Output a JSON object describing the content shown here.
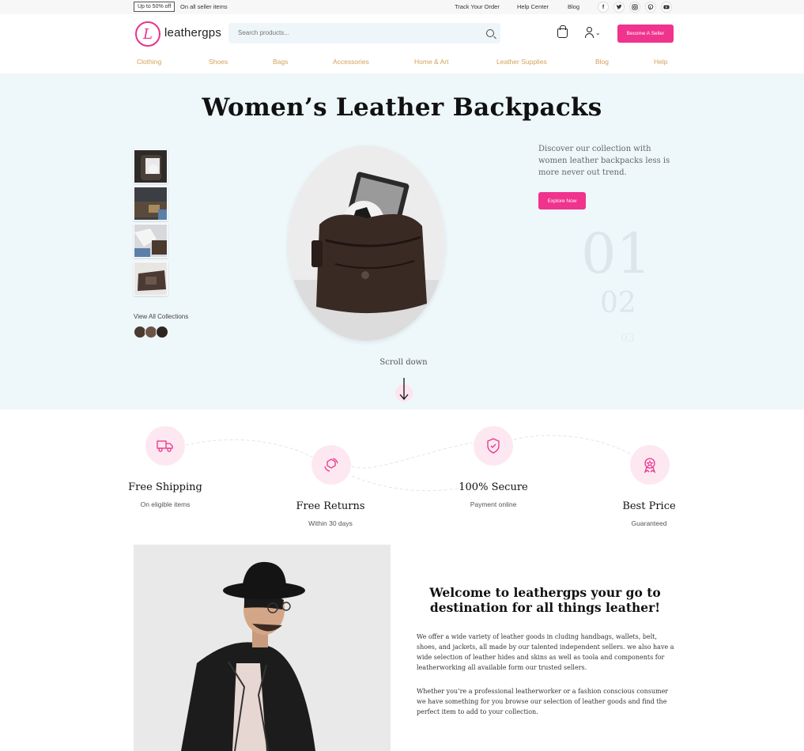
{
  "topbar": {
    "promo_badge": "Up to 50% off",
    "promo_note": "On all seller items",
    "links": [
      "Track Your Order",
      "Help Center",
      "Blog"
    ],
    "socials": [
      "facebook-icon",
      "twitter-icon",
      "instagram-icon",
      "pinterest-icon",
      "youtube-icon"
    ]
  },
  "header": {
    "logo_text": "leathergps",
    "search_placeholder": "Search products...",
    "seller_button": "Become A Seller"
  },
  "nav": [
    "Clothing",
    "Shoes",
    "Bags",
    "Accessories",
    "Home & Art",
    "Leather Supplies",
    "Blog",
    "Help"
  ],
  "hero": {
    "title": "Women’s Leather Backpacks",
    "description": "Discover our collection with women leather backpacks less is more never out trend.",
    "explore_button": "Explore Now",
    "view_all": "View All Collections",
    "slide_numbers": [
      "01",
      "02",
      "03"
    ],
    "scroll_label": "Scroll down"
  },
  "features": [
    {
      "title": "Free Shipping",
      "subtitle": "On eligible items"
    },
    {
      "title": "Free Returns",
      "subtitle": "Within 30 days"
    },
    {
      "title": "100% Secure",
      "subtitle": "Payment online"
    },
    {
      "title": "Best Price",
      "subtitle": "Guaranteed"
    }
  ],
  "welcome": {
    "title": "Welcome to leathergps your go to destination for all things leather!",
    "paragraph1": "We offer a wide variety of leather goods in cluding handbags, wallets, belt, shoes, and jackets, all made by our talented independent sellers. we also have a wide selection of leather hides and skins as well as toola and components for leatherworking all available form our trusted sellers.",
    "paragraph2": "Whether you’re a professional leatherworker or a fashion conscious consumer we have something for you browse our selection of leather goods and find the perfect item to add to your collection."
  },
  "colors": {
    "accent": "#f0338d",
    "hero_bg": "#eef7fa",
    "nav_text": "#d4a15a"
  }
}
